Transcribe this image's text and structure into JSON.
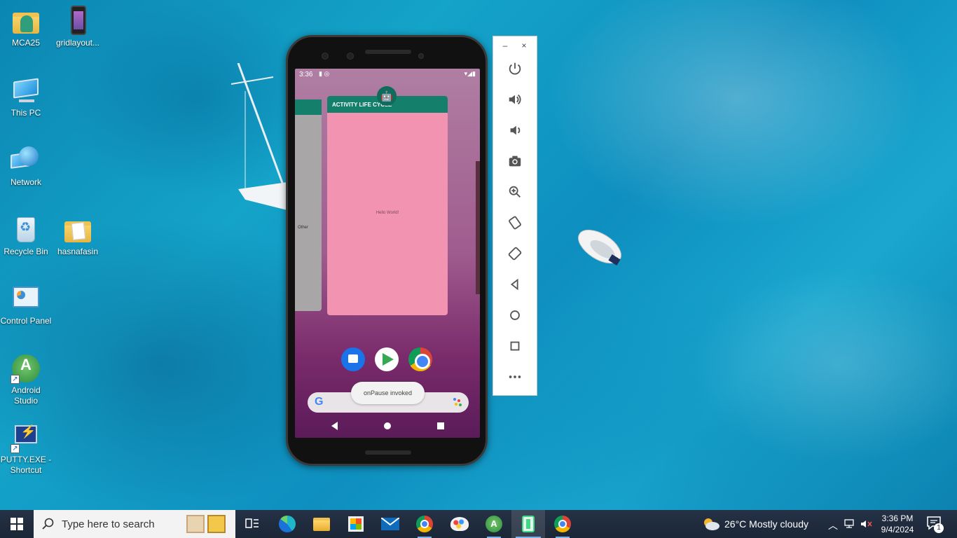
{
  "desktop": {
    "icons": [
      {
        "label": "MCA25",
        "icon": "user-folder-icon"
      },
      {
        "label": "gridlayout...",
        "icon": "phone-app-icon"
      },
      {
        "label": "This PC",
        "icon": "computer-icon"
      },
      {
        "label": "Network",
        "icon": "network-icon"
      },
      {
        "label": "Recycle Bin",
        "icon": "recycle-bin-icon"
      },
      {
        "label": "hasnafasin",
        "icon": "folder-icon"
      },
      {
        "label": "Control Panel",
        "icon": "control-panel-icon"
      },
      {
        "label": "Android Studio",
        "icon": "android-studio-icon"
      },
      {
        "label": "PUTTY.EXE - Shortcut",
        "icon": "putty-icon"
      }
    ]
  },
  "emulator": {
    "status_time": "3:36",
    "recents_card": {
      "title": "ACTIVITY LIFE CYCLE",
      "body": "Hello World!"
    },
    "left_card_text": "Other",
    "toast": "onPause invoked",
    "dock": [
      "messages-icon",
      "play-store-icon",
      "chrome-icon"
    ],
    "search_logo": "G"
  },
  "toolbar": {
    "minimize": "–",
    "close": "×",
    "buttons": [
      "power-icon",
      "volume-up-icon",
      "volume-down-icon",
      "camera-icon",
      "zoom-icon",
      "rotate-left-icon",
      "rotate-right-icon",
      "back-icon",
      "home-icon",
      "overview-icon",
      "more-icon"
    ]
  },
  "taskbar": {
    "search_placeholder": "Type here to search",
    "weather": "26°C  Mostly cloudy",
    "time": "3:36 PM",
    "date": "9/4/2024",
    "notification_count": "1",
    "accent": "#7bb3e8"
  }
}
